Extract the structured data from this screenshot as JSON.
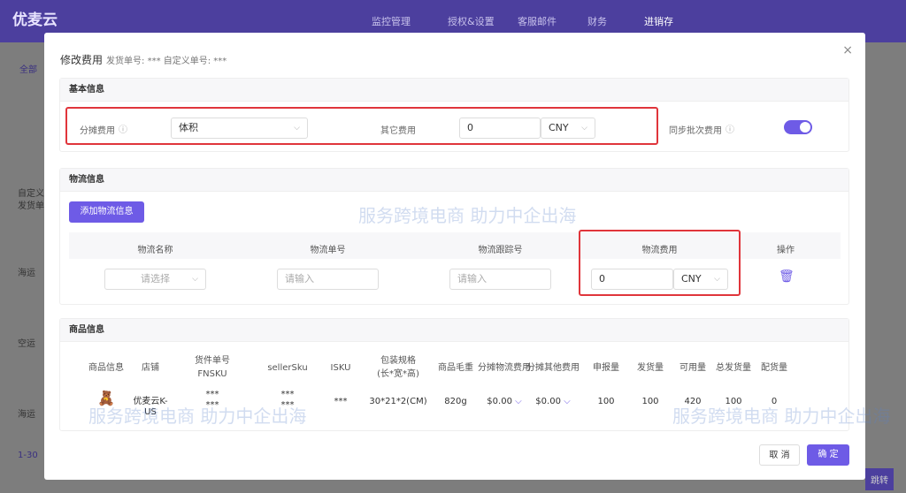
{
  "app": {
    "logo": "优麦云",
    "nav": [
      "授权&设置",
      "客服邮件",
      "财务",
      "进销存"
    ],
    "nav_partial": "监控管理"
  },
  "bg": {
    "tab_all": "全部",
    "col1": "自定义",
    "col2": "发货单",
    "rows": [
      "海运",
      "空运",
      "海运"
    ],
    "pagination": "1-30",
    "jump": "跳转"
  },
  "modal": {
    "title": "修改费用",
    "subtitle": "发货单号: *** 自定义单号: ***",
    "close": "×",
    "basic": {
      "header": "基本信息",
      "alloc_label": "分摊费用",
      "alloc_value": "体积",
      "other_label": "其它费用",
      "other_value": "0",
      "other_currency": "CNY",
      "sync_label": "同步批次费用",
      "sync_on": true
    },
    "logistics": {
      "header": "物流信息",
      "add_button": "添加物流信息",
      "columns": [
        "物流名称",
        "物流单号",
        "物流跟踪号",
        "物流费用",
        "操作"
      ],
      "row": {
        "name_placeholder": "请选择",
        "no_placeholder": "请输入",
        "track_placeholder": "请输入",
        "fee": "0",
        "currency": "CNY"
      }
    },
    "products": {
      "header": "商品信息",
      "columns": [
        "商品信息",
        "店铺",
        "货件单号\nFNSKU",
        "sellerSku",
        "ISKU",
        "包装规格\n(长*宽*高)",
        "商品毛重",
        "分摊物流费用",
        "分摊其他费用",
        "申报量",
        "发货量",
        "可用量",
        "总发货量",
        "配货量"
      ],
      "row": [
        "",
        "优麦云K-US",
        "***\n***",
        "***\n***",
        "***",
        "30*21*2(CM)",
        "820g",
        "$0.00",
        "$0.00",
        "100",
        "100",
        "420",
        "100",
        "0"
      ]
    },
    "cancel": "取 消",
    "confirm": "确 定"
  },
  "watermark": "服务跨境电商 助力中企出海"
}
